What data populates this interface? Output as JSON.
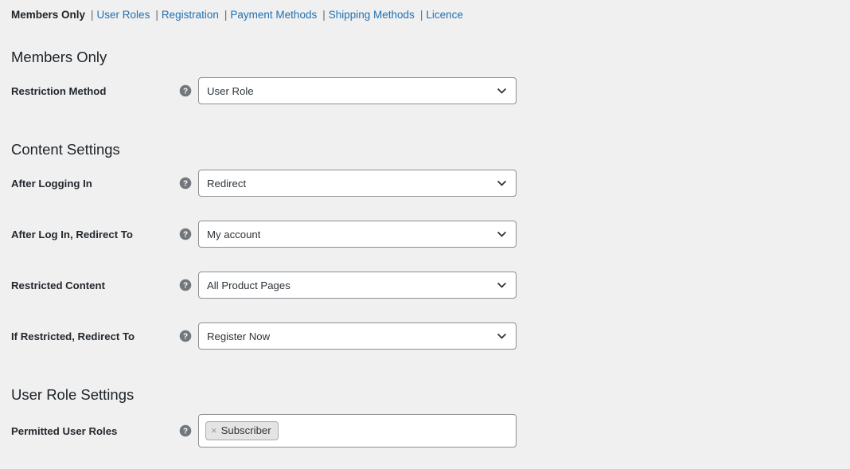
{
  "subnav": {
    "separator": "|",
    "items": [
      {
        "label": "Members Only",
        "current": true
      },
      {
        "label": "User Roles",
        "current": false
      },
      {
        "label": "Registration",
        "current": false
      },
      {
        "label": "Payment Methods",
        "current": false
      },
      {
        "label": "Shipping Methods",
        "current": false
      },
      {
        "label": "Licence",
        "current": false
      }
    ]
  },
  "sections": [
    {
      "heading": "Members Only"
    },
    {
      "heading": "Content Settings"
    },
    {
      "heading": "User Role Settings"
    }
  ],
  "fields": {
    "restriction_method": {
      "label": "Restriction Method",
      "help_icon": "help-question-icon",
      "value": "User Role",
      "control": "select"
    },
    "after_logging_in": {
      "label": "After Logging In",
      "help_icon": "help-question-icon",
      "value": "Redirect",
      "control": "select"
    },
    "after_login_redirect_to": {
      "label": "After Log In, Redirect To",
      "help_icon": "help-question-icon",
      "value": "My account",
      "control": "select"
    },
    "restricted_content": {
      "label": "Restricted Content",
      "help_icon": "help-question-icon",
      "value": "All Product Pages",
      "control": "select"
    },
    "if_restricted_redirect_to": {
      "label": "If Restricted, Redirect To",
      "help_icon": "help-question-icon",
      "value": "Register Now",
      "control": "select"
    },
    "permitted_user_roles": {
      "label": "Permitted User Roles",
      "help_icon": "help-question-icon",
      "control": "multiselect",
      "tags": [
        {
          "remove": "×",
          "label": "Subscriber"
        }
      ]
    }
  },
  "colors": {
    "page_background": "#f0f0f1",
    "link": "#2271b1",
    "text": "#1d2327",
    "input_border": "#8c8f94",
    "input_background": "#ffffff",
    "tag_background": "#e4e4e4",
    "tag_border": "#aaaaaa",
    "help_icon": "#72777c"
  }
}
